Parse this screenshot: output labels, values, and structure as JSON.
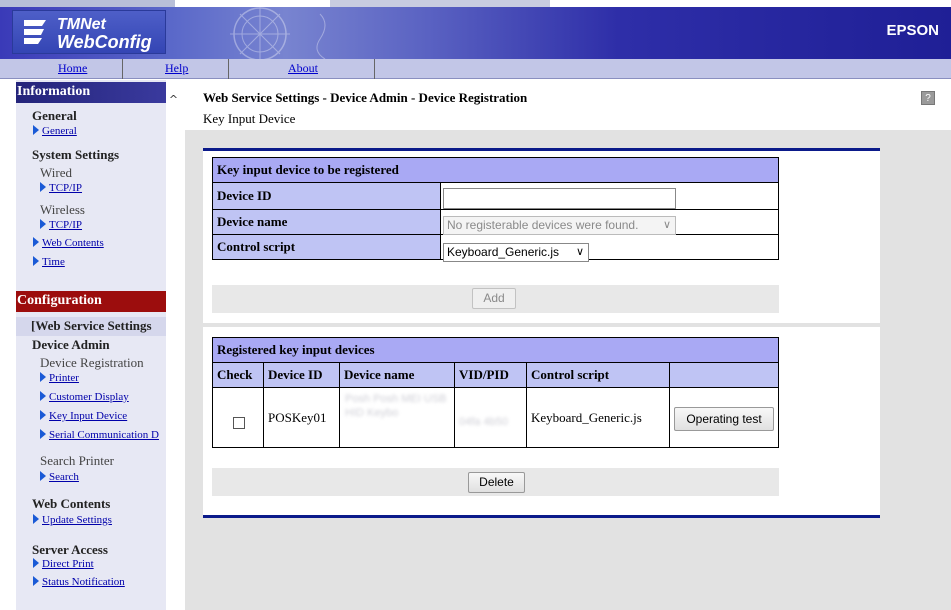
{
  "header": {
    "logo_line1": "TMNet",
    "logo_line2": "WebConfig",
    "brand": "EPSON"
  },
  "nav": {
    "home": "Home",
    "help": "Help",
    "about": "About"
  },
  "sidebar": {
    "information": {
      "title": "Information",
      "general": "General",
      "general_link": "General",
      "system_settings": "System Settings",
      "wired": "Wired",
      "wired_tcpip": "TCP/IP",
      "wireless": "Wireless",
      "wireless_tcpip": "TCP/IP",
      "web_contents": "Web Contents",
      "time": "Time"
    },
    "configuration": {
      "title": "Configuration",
      "active": "[Web Service Settings",
      "device_admin": "Device Admin",
      "device_registration": "Device Registration",
      "printer": "Printer",
      "customer_display": "Customer Display",
      "key_input_device": "Key Input Device",
      "serial_comm": "Serial Communication D",
      "search_printer": "Search Printer",
      "search": "Search",
      "web_contents": "Web Contents",
      "update_settings": "Update Settings",
      "server_access": "Server Access",
      "direct_print": "Direct Print",
      "status_notification": "Status Notification"
    }
  },
  "main": {
    "title": "Web Service Settings - Device Admin - Device Registration",
    "subtitle": "Key Input Device",
    "help_icon": "?",
    "register_form": {
      "header": "Key input device to be registered",
      "device_id_label": "Device ID",
      "device_id_value": "",
      "device_name_label": "Device name",
      "device_name_selected": "No registerable devices were found.",
      "control_script_label": "Control script",
      "control_script_selected": "Keyboard_Generic.js",
      "add_button": "Add"
    },
    "registered": {
      "header": "Registered key input devices",
      "columns": [
        "Check",
        "Device ID",
        "Device name",
        "VID/PID",
        "Control script"
      ],
      "rows": [
        {
          "checked": false,
          "device_id": "POSKey01",
          "device_name": "Posh Posh MEI USB HID Keybo",
          "vid_pid": "04fa 4b50",
          "control_script": "Keyboard_Generic.js",
          "test_button": "Operating test"
        }
      ],
      "delete_button": "Delete"
    }
  },
  "colors": {
    "sidebar_info_header": "#24247a",
    "sidebar_config_header": "#9c0d0d",
    "table_header": "#a9a9f4",
    "table_label": "#bfc4f4",
    "panel_border": "#0b1a8a"
  }
}
